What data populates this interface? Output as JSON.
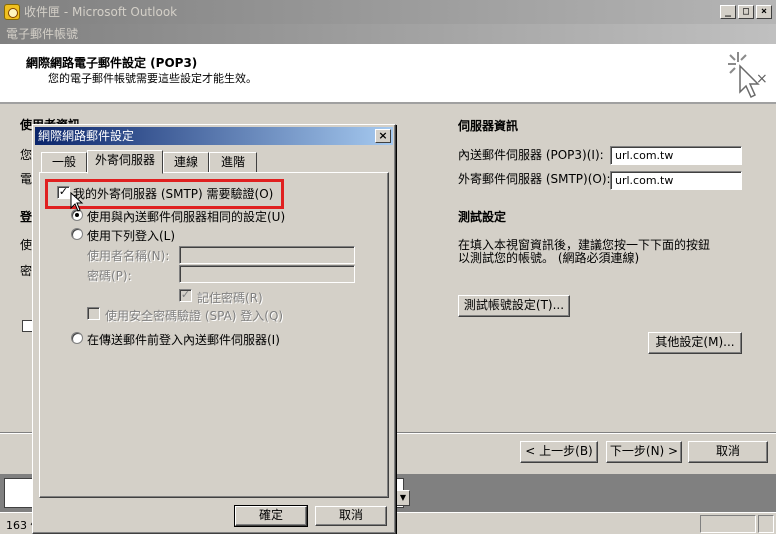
{
  "outlook": {
    "title": "收件匣 - Microsoft Outlook",
    "min_glyph": "_",
    "max_glyph": "□",
    "close_glyph": "×",
    "status_text": "163 個"
  },
  "wizard": {
    "title": "電子郵件帳號",
    "heading": "網際網路電子郵件設定 (POP3)",
    "subheading": "您的電子郵件帳號需要這些設定才能生效。",
    "close_glyph": "×",
    "user_info_label": "使用者資訊",
    "partial_labels": [
      "您",
      "電",
      "登",
      "使",
      "密"
    ],
    "server_info_label": "伺服器資訊",
    "incoming_label": "內送郵件伺服器 (POP3)(I):",
    "incoming_value": "url.com.tw",
    "outgoing_label": "外寄郵件伺服器 (SMTP)(O):",
    "outgoing_value": "url.com.tw",
    "test_settings_label": "測試設定",
    "test_desc_line1": "在填入本視窗資訊後，建議您按一下下面的按鈕",
    "test_desc_line2": "以測試您的帳號。 (網路必須連線)",
    "test_button": "測試帳號設定(T)...",
    "more_settings_button": "其他設定(M)...",
    "back_button": "< 上一步(B)",
    "next_button": "下一步(N) >",
    "cancel_button": "取消"
  },
  "dialog": {
    "title": "網際網路郵件設定",
    "close_glyph": "×",
    "tabs": [
      "一般",
      "外寄伺服器",
      "連線",
      "進階"
    ],
    "active_tab": "外寄伺服器",
    "smtp_auth_label": "我的外寄伺服器 (SMTP) 需要驗證(O)",
    "smtp_auth_checked": true,
    "check_glyph": "✓",
    "same_settings_label": "使用與內送郵件伺服器相同的設定(U)",
    "login_with_label": "使用下列登入(L)",
    "username_label": "使用者名稱(N):",
    "password_label": "密碼(P):",
    "remember_password_label": "記住密碼(R)",
    "spa_label": "使用安全密碼驗證 (SPA) 登入(Q)",
    "log_on_before_label": "在傳送郵件前登入內送郵件伺服器(I)",
    "ok_button": "確定",
    "cancel_button": "取消"
  },
  "colors": {
    "highlight": "#e02020",
    "active_title": "#0a246a",
    "face": "#d4d0c8"
  }
}
